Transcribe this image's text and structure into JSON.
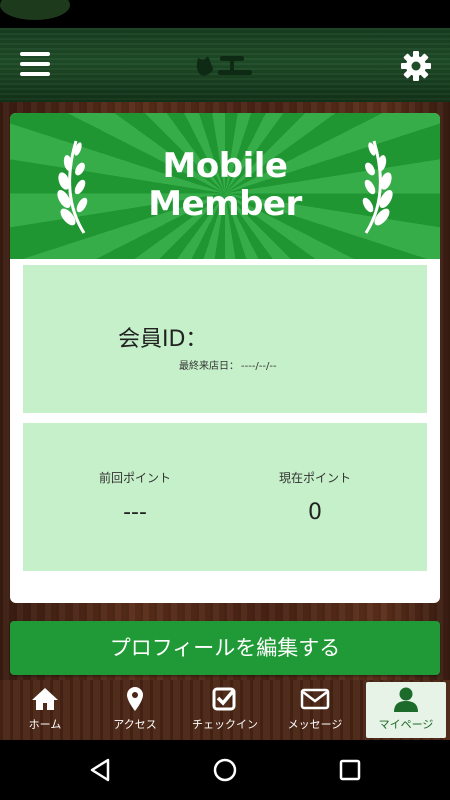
{
  "header": {
    "menu_icon": "hamburger-menu-icon",
    "logo_icon": "shop-logo",
    "settings_icon": "gear-icon"
  },
  "card": {
    "banner_title": "Mobile\nMember",
    "member_id_label": "会員ID：",
    "last_visit_label": "最終来店日：",
    "last_visit_value": "----/--/--",
    "previous_points_label": "前回ポイント",
    "previous_points_value": "---",
    "current_points_label": "現在ポイント",
    "current_points_value": "0"
  },
  "edit_profile_button": "プロフィールを編集する",
  "tabs": [
    {
      "label": "ホーム",
      "icon": "home-icon"
    },
    {
      "label": "アクセス",
      "icon": "map-pin-icon"
    },
    {
      "label": "チェックイン",
      "icon": "checkbox-icon"
    },
    {
      "label": "メッセージ",
      "icon": "envelope-icon"
    },
    {
      "label": "マイページ",
      "icon": "person-icon",
      "active": true
    }
  ],
  "system_nav": {
    "back_icon": "back-triangle-icon",
    "home_icon": "home-circle-icon",
    "recents_icon": "recents-square-icon"
  },
  "colors": {
    "accent_green": "#1f9a36",
    "panel_green": "#c6f0c9",
    "wood_brown": "#4a2515"
  }
}
